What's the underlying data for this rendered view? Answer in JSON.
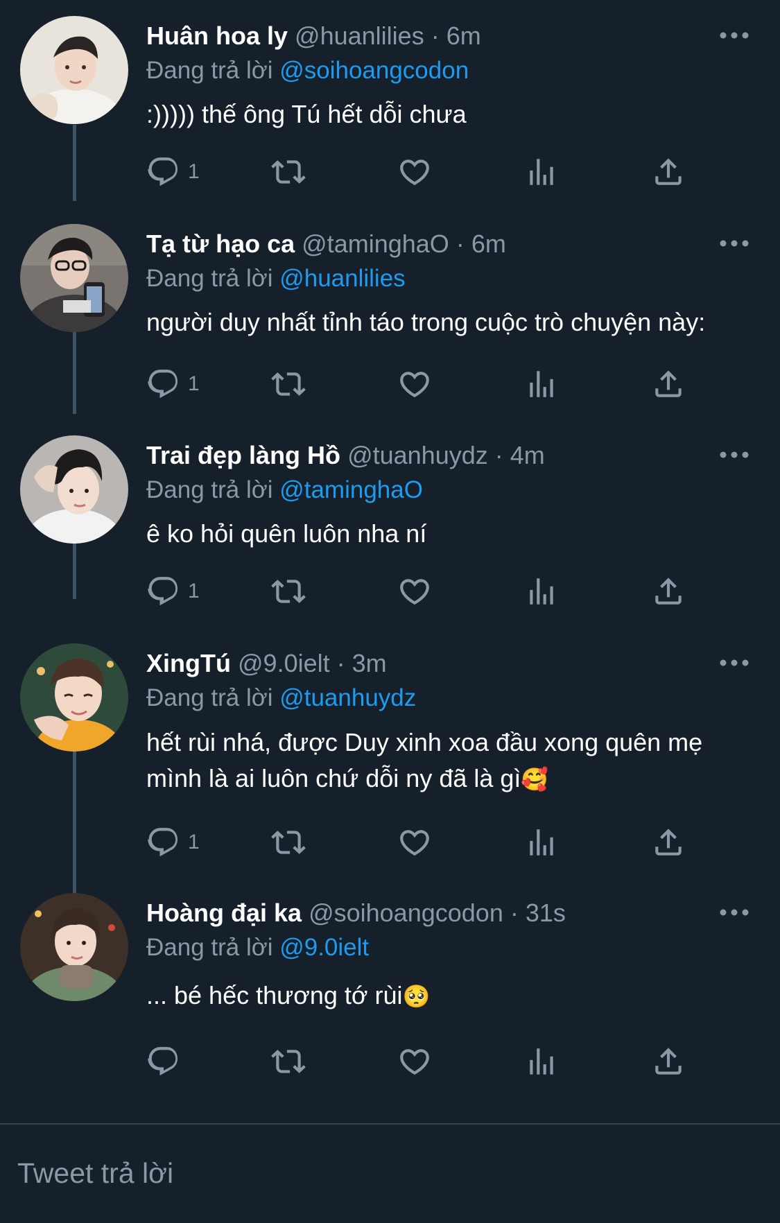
{
  "tweets": [
    {
      "name": "Huân hoa ly",
      "handle": "@huanlilies",
      "time": "6m",
      "replying_label": "Đang trả lời",
      "replying_to": "@soihoangcodon",
      "text": ":))))) thế ông Tú hết dỗi chưa",
      "emoji": "",
      "reply_count": "1"
    },
    {
      "name": "Tạ từ hạo ca",
      "handle": "@taminghaO",
      "time": "6m",
      "replying_label": "Đang trả lời",
      "replying_to": "@huanlilies",
      "text": "người duy nhất tỉnh táo trong cuộc trò chuyện này:",
      "emoji": "",
      "reply_count": "1"
    },
    {
      "name": "Trai đẹp làng Hồ",
      "handle": "@tuanhuydz",
      "time": "4m",
      "replying_label": "Đang trả lời",
      "replying_to": "@taminghaO",
      "text": "ê ko hỏi quên luôn nha ní",
      "emoji": "",
      "reply_count": "1"
    },
    {
      "name": "XingTú",
      "handle": "@9.0ielt",
      "time": "3m",
      "replying_label": "Đang trả lời",
      "replying_to": "@tuanhuydz",
      "text": "hết rùi nhá, được Duy xinh xoa đầu xong quên mẹ mình là ai luôn chứ dỗi ny đã là gì",
      "emoji": "🥰",
      "reply_count": "1"
    },
    {
      "name": "Hoàng đại ka",
      "handle": "@soihoangcodon",
      "time": "31s",
      "replying_label": "Đang trả lời",
      "replying_to": "@9.0ielt",
      "text": "... bé hếc thương tớ rùi",
      "emoji": "🥺",
      "reply_count": ""
    }
  ],
  "separator": "·",
  "compose": {
    "placeholder": "Tweet trả lời"
  },
  "colors": {
    "background": "#15202b",
    "text_primary": "#ffffff",
    "text_secondary": "#8b98a5",
    "accent_link": "#1d9bf0",
    "thread_line": "#3d5466"
  },
  "icons": [
    "more-icon",
    "reply-icon",
    "retweet-icon",
    "like-icon",
    "stats-icon",
    "share-icon"
  ]
}
